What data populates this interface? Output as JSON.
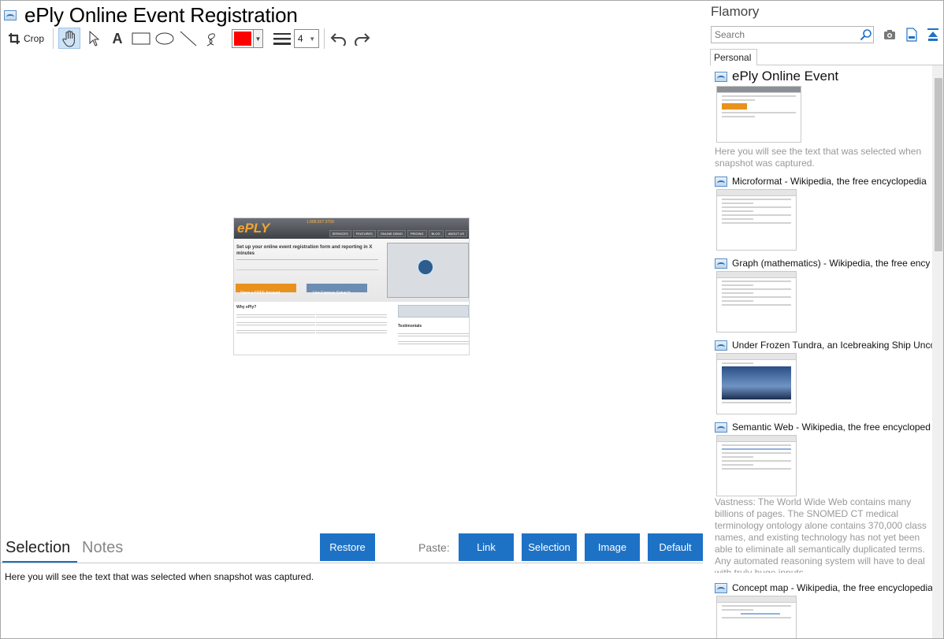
{
  "window": {
    "title": "ePly Online Event Registration"
  },
  "toolbar": {
    "crop_label": "Crop",
    "color": "#ff0000",
    "line_width": "4"
  },
  "snapshot": {
    "logo": "ePLY",
    "phone": "1.888.507.3759",
    "nav": [
      "SERVICES",
      "FEATURES",
      "ONLINE DEMO",
      "PRICING",
      "BLOG",
      "ABOUT US"
    ],
    "headline": "Set up your online event registration form and reporting in X minutes",
    "button_primary": "Open a FREE Account",
    "button_secondary": "Use Express Setup™",
    "why": "Why ePly?",
    "testimonials": "Testimonials"
  },
  "tabs": {
    "selection": "Selection",
    "notes": "Notes"
  },
  "actions": {
    "restore": "Restore",
    "paste_label": "Paste:",
    "link": "Link",
    "selection": "Selection",
    "image": "Image",
    "default": "Default"
  },
  "selection_text": "Here you will see the text that was selected when snapshot was captured.",
  "sidebar": {
    "brand": "Flamory",
    "search_placeholder": "Search",
    "tab": "Personal",
    "items": [
      {
        "title": "ePly Online Event",
        "note": "Here you will see the text that was selected when snapshot was captured."
      },
      {
        "title": "Microformat - Wikipedia, the free encyclopedia"
      },
      {
        "title": "Graph (mathematics) - Wikipedia, the free ency"
      },
      {
        "title": "Under Frozen Tundra, an Icebreaking Ship Unco"
      },
      {
        "title": "Semantic Web - Wikipedia, the free encycloped",
        "note": "Vastness: The World Wide Web contains many billions of pages. The SNOMED CT medical terminology ontology alone contains 370,000 class names, and existing technology has not yet been able to eliminate all semantically duplicated terms. Any automated reasoning system will have to deal with truly huge inputs."
      },
      {
        "title": "Concept map - Wikipedia, the free encyclopedia"
      }
    ]
  }
}
